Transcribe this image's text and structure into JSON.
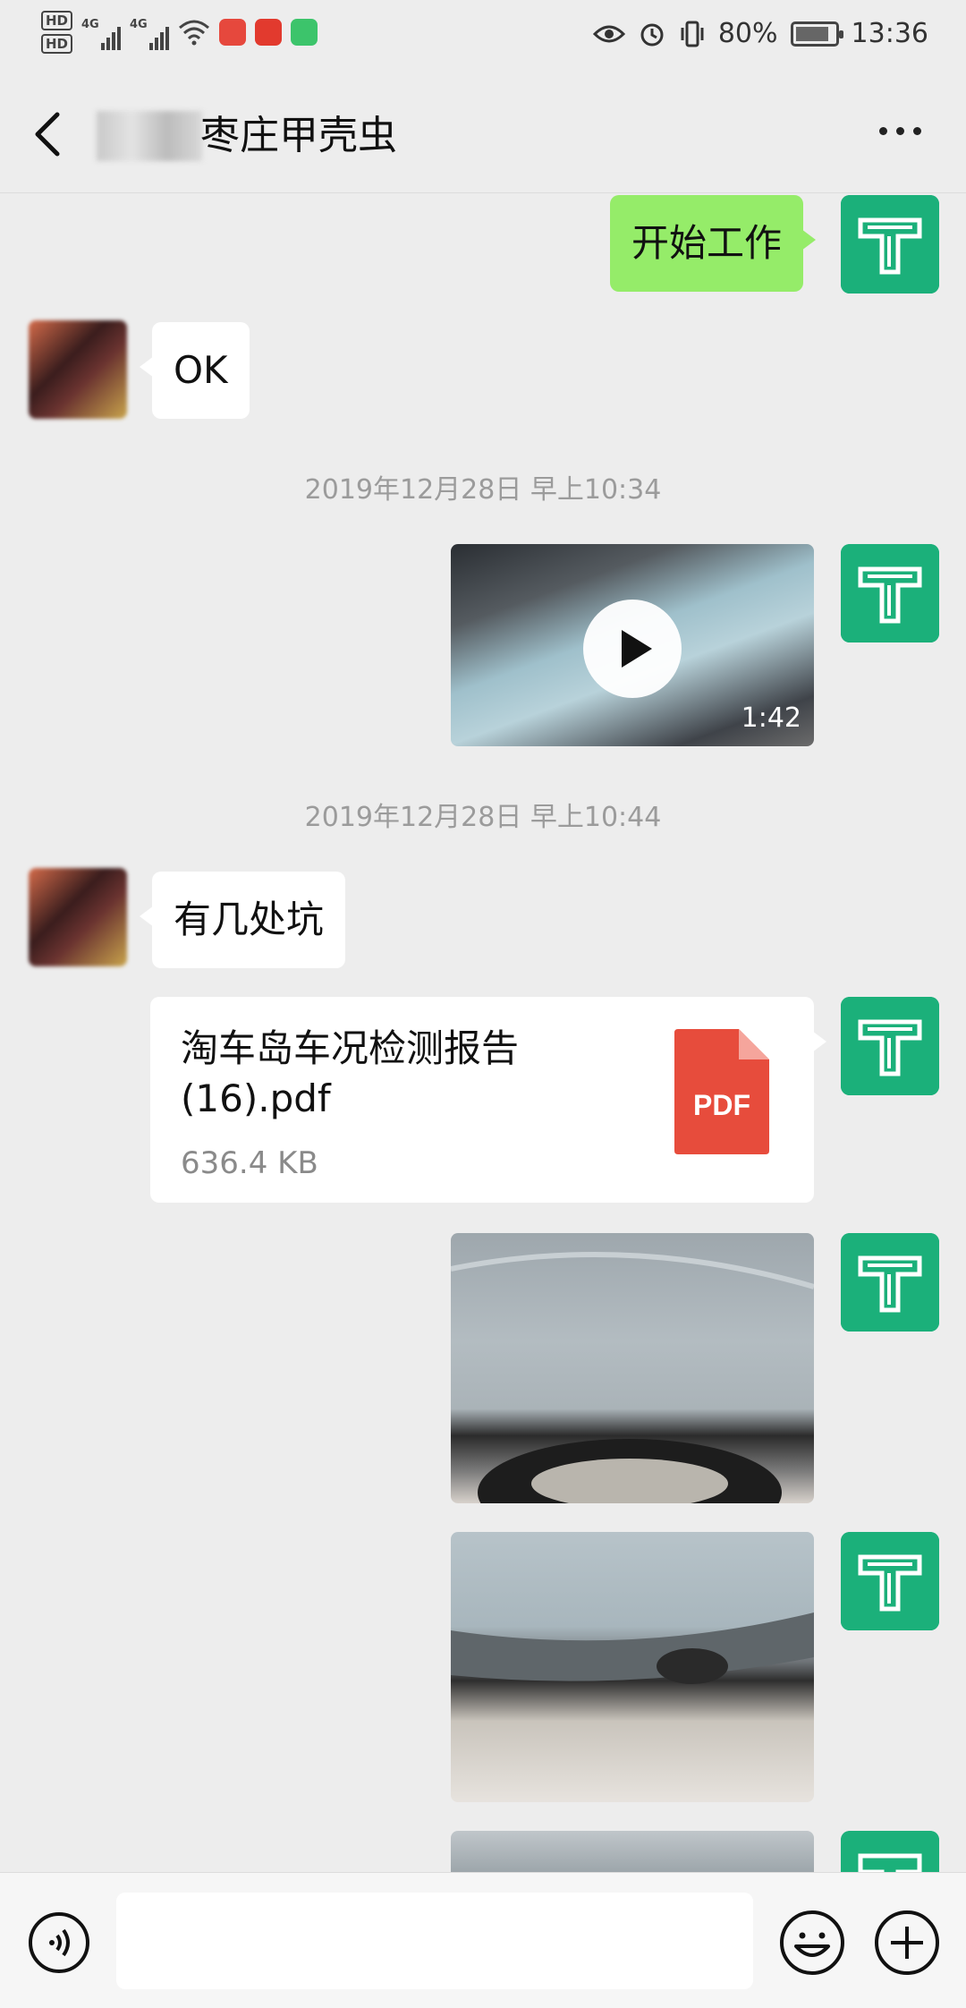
{
  "status_bar": {
    "hd1": "HD",
    "hd2": "HD",
    "net1": "4G",
    "net2": "4G",
    "battery": "80%",
    "time": "13:36"
  },
  "header": {
    "title": "枣庄甲壳虫"
  },
  "messages": {
    "m1_text": "开始工作",
    "m2_text": "OK",
    "time1": "2019年12月28日 早上10:34",
    "video_duration": "1:42",
    "time2": "2019年12月28日 早上10:44",
    "m4_text": "有几处坑",
    "file_name": "淘车岛车况检测报告(16).pdf",
    "file_size": "636.4 KB",
    "file_badge": "PDF"
  },
  "colors": {
    "sent_bubble": "#95ec69",
    "received_bubble": "#ffffff",
    "my_avatar": "#1bb07a",
    "pdf_red": "#e74c3c"
  },
  "icons": [
    "back-arrow-icon",
    "more-icon",
    "voice-icon",
    "emoji-icon",
    "plus-icon",
    "play-icon",
    "pdf-icon"
  ]
}
